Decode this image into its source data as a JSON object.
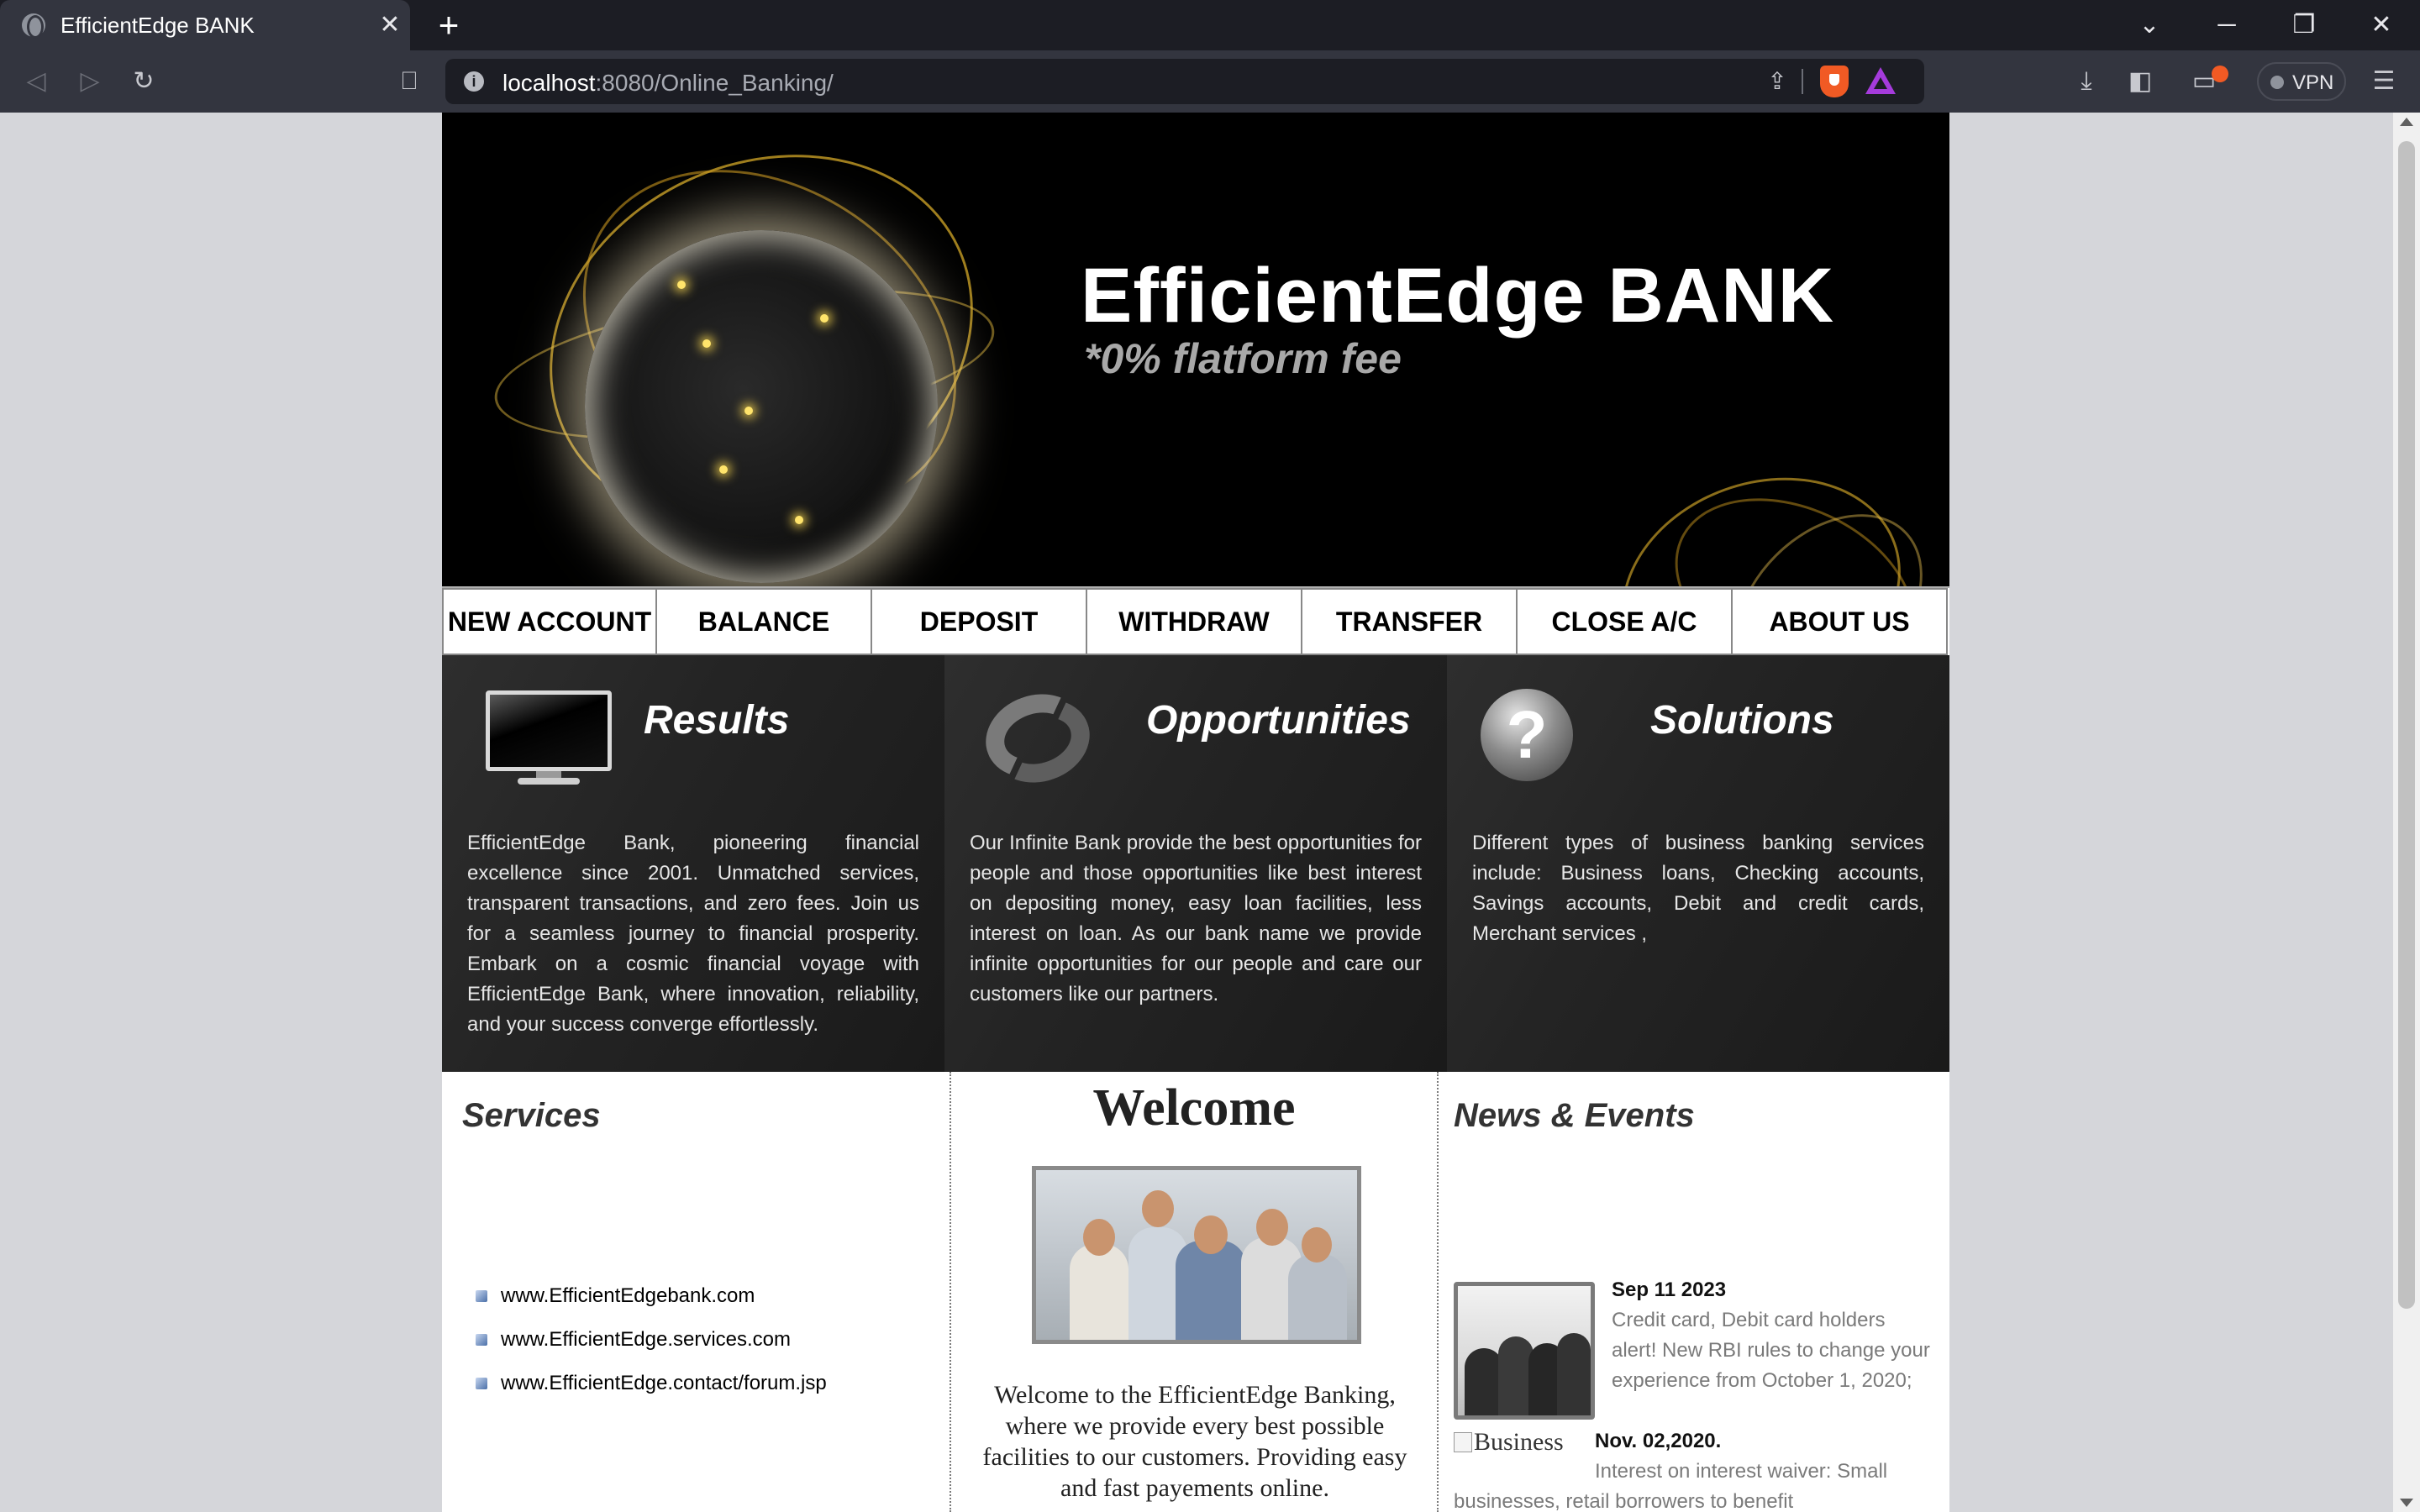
{
  "browser": {
    "tab_title": "EfficientEdge BANK",
    "url_host": "localhost",
    "url_rest": ":8080/Online_Banking/",
    "vpn_label": "VPN"
  },
  "header": {
    "title": "EfficientEdge BANK",
    "tagline": "*0% flatform fee"
  },
  "nav": {
    "items": [
      "NEW ACCOUNT",
      "BALANCE",
      "DEPOSIT",
      "WITHDRAW",
      "TRANSFER",
      "CLOSE A/C",
      "ABOUT US"
    ]
  },
  "features": [
    {
      "icon": "monitor-icon",
      "title": "Results",
      "text": "EfficientEdge Bank, pioneering financial excellence since 2001. Unmatched services, transparent transactions, and zero fees. Join us for a seamless journey to financial prosperity. Embark on a cosmic financial voyage with EfficientEdge Bank, where innovation, reliability, and your success converge effortlessly."
    },
    {
      "icon": "refresh-arrows-icon",
      "title": "Opportunities",
      "text": "Our Infinite Bank provide the best opportunities for people and those opportunities like best interest on depositing money, easy loan facilities, less interest on loan. As our bank name we provide infinite opportunities for our people and care our customers like our partners."
    },
    {
      "icon": "question-mark-icon",
      "title": "Solutions",
      "text": "Different types of business banking services include: Business loans, Checking accounts, Savings accounts, Debit and credit cards, Merchant services ,"
    }
  ],
  "services": {
    "title": "Services",
    "links": [
      "www.EfficientEdgebank.com",
      "www.EfficientEdge.services.com",
      "www.EfficientEdge.contact/forum.jsp"
    ]
  },
  "welcome": {
    "title": "Welcome",
    "text": "Welcome to the EfficientEdge Banking, where we provide every best possible facilities to our customers. Providing easy and fast payements online."
  },
  "news": {
    "title": "News & Events",
    "items": [
      {
        "date": "Sep 11 2023",
        "text": "Credit card, Debit card holders alert! New RBI rules to change your experience from October 1, 2020;"
      },
      {
        "image_alt": "Business",
        "date": "Nov. 02,2020.",
        "text": "Interest on interest waiver: Small businesses, retail borrowers to benefit"
      }
    ]
  },
  "colors": {
    "banner_bg": "#000000",
    "feature_bg": "#242424",
    "browser_chrome": "#33353f",
    "page_bg": "#d5d6da",
    "news_text": "#7a7a7a"
  }
}
